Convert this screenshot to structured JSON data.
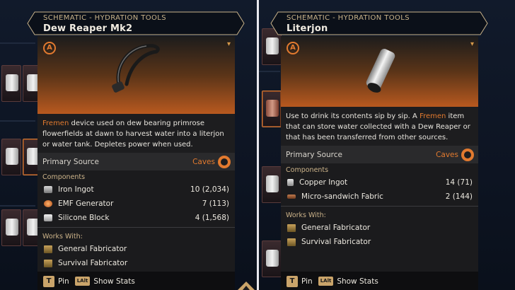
{
  "colors": {
    "accent": "#e27a2f",
    "category": "#c9b38a",
    "panel": "#1b1b1d"
  },
  "tooltips": [
    {
      "category": "SCHEMATIC - HYDRATION TOOLS",
      "name": "Dew Reaper Mk2",
      "description_highlight": "Fremen",
      "description_rest": " device used on dew bearing primrose flowerfields at dawn to harvest water into a literjon or water tank. Depletes power when used.",
      "source_label": "Primary Source",
      "source_value": "Caves",
      "components_title": "Components",
      "components": [
        {
          "name": "Iron Ingot",
          "qty": "10 (2,034)",
          "icon": "ingot-icon"
        },
        {
          "name": "EMF Generator",
          "qty": "7 (113)",
          "icon": "generator-icon"
        },
        {
          "name": "Silicone Block",
          "qty": "4 (1,568)",
          "icon": "block-icon"
        }
      ],
      "works_title": "Works With:",
      "works": [
        "General Fabricator",
        "Survival Fabricator"
      ],
      "footer": {
        "pin_key": "T",
        "pin_label": "Pin",
        "stats_key": "LAlt",
        "stats_label": "Show Stats"
      }
    },
    {
      "category": "SCHEMATIC - HYDRATION TOOLS",
      "name": "Literjon",
      "description_pre": "Use to drink its contents sip by sip. A ",
      "description_highlight": "Fremen",
      "description_rest": " item that can store water collected with a Dew Reaper or that has been transferred from other sources.",
      "source_label": "Primary Source",
      "source_value": "Caves",
      "components_title": "Components",
      "components": [
        {
          "name": "Copper Ingot",
          "qty": "14 (71)",
          "icon": "ingot-icon"
        },
        {
          "name": "Micro-sandwich Fabric",
          "qty": "2 (144)",
          "icon": "fabric-icon"
        }
      ],
      "works_title": "Works With:",
      "works": [
        "General Fabricator",
        "Survival Fabricator"
      ],
      "footer": {
        "pin_key": "T",
        "pin_label": "Pin",
        "stats_key": "LAlt",
        "stats_label": "Show Stats"
      }
    }
  ]
}
